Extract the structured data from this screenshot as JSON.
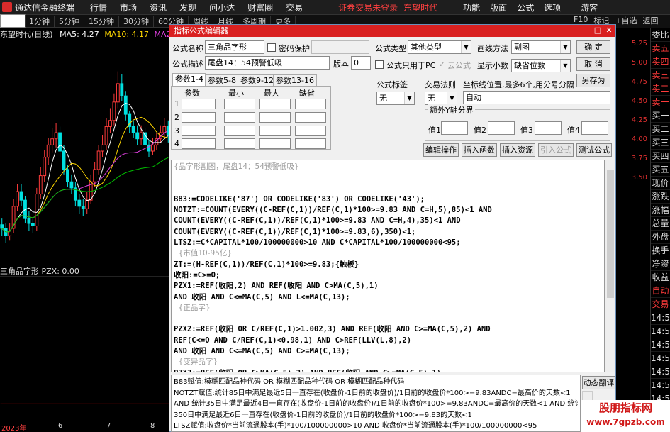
{
  "app": {
    "title": "通达信金融终端",
    "menu": [
      "行情",
      "市场",
      "资讯",
      "发现",
      "问小达",
      "财富圈",
      "交易"
    ],
    "warning": "证券交易未登录",
    "brand": "东望时代",
    "right_menu": [
      "功能",
      "版面",
      "公式",
      "选项"
    ],
    "visitor": "游客"
  },
  "periods": [
    "分时",
    "1分钟",
    "5分钟",
    "15分钟",
    "30分钟",
    "60分钟",
    "日线",
    "周线",
    "月线",
    "多周期",
    "更多"
  ],
  "top_right": [
    "F10",
    "标记",
    "+自选",
    "返回"
  ],
  "chart": {
    "name": "东望时代(日线)",
    "ma5": "MA5: 4.27",
    "ma10": "MA10: 4.17",
    "ma20": "MA20: 3.92",
    "sub_header": "三角品字形 PZX: 0.00",
    "x_labels": [
      "2023年",
      "6",
      "7",
      "8"
    ],
    "prices": [
      "5.25",
      "5.00",
      "4.75",
      "4.50",
      "4.25",
      "4.00",
      "3.75",
      "3.50"
    ],
    "colors": {
      "up": "#ff3b3b",
      "down": "#00e0e0",
      "ma5": "#ffffff",
      "ma10": "#ffd700",
      "ma20": "#e040e0",
      "ma60": "#00c000"
    },
    "series": {
      "open": [
        3.65,
        3.62,
        3.56,
        3.62,
        3.8,
        3.92,
        3.85,
        3.7,
        3.66,
        3.64,
        3.9,
        4.05,
        4.2,
        4.3,
        4.35,
        4.4,
        4.25,
        4.1,
        4.0,
        3.95,
        3.85,
        3.8,
        3.78,
        3.85,
        4.0,
        4.1,
        4.25,
        4.3,
        4.45,
        4.5,
        4.65,
        4.8,
        4.7,
        4.55,
        4.45,
        4.4,
        4.35,
        4.4,
        4.3,
        4.25,
        4.3,
        4.35,
        4.4,
        4.45
      ],
      "close": [
        3.62,
        3.56,
        3.6,
        3.8,
        3.92,
        3.85,
        3.7,
        3.66,
        3.64,
        3.9,
        4.05,
        4.2,
        4.3,
        4.35,
        4.4,
        4.25,
        4.1,
        4.0,
        3.95,
        3.85,
        3.8,
        3.78,
        3.85,
        4.0,
        4.1,
        4.25,
        4.3,
        4.45,
        4.5,
        4.65,
        4.8,
        4.7,
        4.55,
        4.45,
        4.4,
        4.35,
        4.4,
        4.3,
        4.25,
        4.3,
        4.35,
        4.4,
        4.45,
        4.38
      ],
      "high": [
        3.7,
        3.66,
        3.66,
        3.86,
        3.98,
        3.98,
        3.88,
        3.76,
        3.7,
        3.95,
        4.12,
        4.26,
        4.36,
        4.44,
        4.48,
        4.45,
        4.3,
        4.14,
        4.06,
        4.0,
        3.9,
        3.86,
        3.92,
        4.06,
        4.16,
        4.3,
        4.38,
        4.52,
        4.6,
        4.72,
        4.9,
        4.88,
        4.74,
        4.58,
        4.5,
        4.46,
        4.46,
        4.44,
        4.34,
        4.36,
        4.4,
        4.46,
        4.52,
        4.5
      ],
      "low": [
        3.56,
        3.5,
        3.52,
        3.58,
        3.76,
        3.8,
        3.66,
        3.6,
        3.58,
        3.6,
        3.86,
        4.0,
        4.14,
        4.24,
        4.28,
        4.2,
        4.06,
        3.96,
        3.9,
        3.8,
        3.74,
        3.72,
        3.74,
        3.82,
        3.96,
        4.06,
        4.2,
        4.26,
        4.4,
        4.46,
        4.6,
        4.66,
        4.5,
        4.4,
        4.36,
        4.3,
        4.3,
        4.26,
        4.2,
        4.22,
        4.26,
        4.32,
        4.36,
        4.32
      ]
    }
  },
  "right_panel": [
    "委比",
    "卖五",
    "卖四",
    "卖三",
    "卖二",
    "卖一",
    "买一",
    "买二",
    "买三",
    "买四",
    "买五",
    "现价",
    "涨跌",
    "涨幅",
    "总量",
    "外盘",
    "换手",
    "净资",
    "收益",
    "自动",
    "交易",
    "14:5",
    "14:5",
    "14:5",
    "14:5",
    "14:5",
    "14:5",
    "14:5",
    "14:5",
    "14:5"
  ],
  "dialog": {
    "title": "指标公式编辑器",
    "name_label": "公式名称",
    "name_value": "三角品字形",
    "pwd_label": "密码保护",
    "type_label": "公式类型",
    "type_value": "其他类型",
    "draw_label": "画线方法",
    "draw_value": "副图",
    "ok": "确  定",
    "desc_label": "公式描述",
    "desc_value": "尾盘14：54预警低吸",
    "ver_label": "版本",
    "ver_value": "0",
    "pc_only": "公式只用于PC",
    "cloud": "云公式",
    "decimal_label": "显示小数",
    "decimal_value": "缺省位数",
    "cancel": "取  消",
    "save_as": "另存为",
    "tabs": [
      "参数1-4",
      "参数5-8",
      "参数9-12",
      "参数13-16"
    ],
    "param_headers": [
      "参数",
      "最小",
      "最大",
      "缺省"
    ],
    "param_rows": [
      "1",
      "2",
      "3",
      "4"
    ],
    "tag_label": "公式标签",
    "tag_value": "无",
    "rule_label": "交易法则",
    "rule_value": "无",
    "axis_label": "坐标线位置,最多6个,用分号分隔",
    "axis_value": "自动",
    "extra_y": "额外Y轴分界",
    "values": [
      "值1",
      "值2",
      "值3",
      "值4"
    ],
    "buttons": [
      "编辑操作",
      "插入函数",
      "插入资源",
      "引入公式",
      "测试公式"
    ],
    "code": [
      {
        "cls": "c",
        "t": "{品字形副图，尾盘14：54预警低吸}"
      },
      {
        "cls": "",
        "t": ""
      },
      {
        "cls": "",
        "t": ""
      },
      {
        "cls": "",
        "t": "B83:=CODELIKE('87') OR CODELIKE('83') OR CODELIKE('43');"
      },
      {
        "cls": "",
        "t": "NOTZT:=COUNT(EVERY((C-REF(C,1))/REF(C,1)*100>=9.83 AND C=H,5),85)<1 AND"
      },
      {
        "cls": "",
        "t": "COUNT(EVERY((C-REF(C,1))/REF(C,1)*100>=9.83 AND C=H,4),35)<1 AND"
      },
      {
        "cls": "",
        "t": "COUNT(EVERY((C-REF(C,1))/REF(C,1)*100>=9.83,6),350)<1;"
      },
      {
        "cls": "",
        "t": "LTSZ:=C*CAPITAL*100/100000000>10 AND C*CAPITAL*100/100000000<95;"
      },
      {
        "cls": "c",
        "t": "  {市值10-95亿}"
      },
      {
        "cls": "",
        "t": "ZT:=(H-REF(C,1))/REF(C,1)*100>=9.83;{触板}"
      },
      {
        "cls": "",
        "t": "收阳:=C>=O;"
      },
      {
        "cls": "",
        "t": "PZX1:=REF(收阳,2) AND REF(收阳 AND C>MA(C,5),1)"
      },
      {
        "cls": "",
        "t": "AND 收阳 AND C<=MA(C,5) AND L<=MA(C,13);"
      },
      {
        "cls": "c",
        "t": "  {正品字}"
      },
      {
        "cls": "",
        "t": ""
      },
      {
        "cls": "",
        "t": "PZX2:=REF(收阳 OR C/REF(C,1)>1.002,3) AND REF(收阳 AND C>=MA(C,5),2) AND"
      },
      {
        "cls": "",
        "t": "REF(C<=O AND C/REF(C,1)<0.98,1) AND C>REF(LLV(L,8),2)"
      },
      {
        "cls": "",
        "t": "AND 收阳 AND C<=MA(C,5) AND C>=MA(C,13);"
      },
      {
        "cls": "c",
        "t": "  {变异品字}"
      },
      {
        "cls": "",
        "t": "PZX3:=REF(收阳 OR C>MA(C,5),2) AND REF(收阳 AND C>=MA(C,5),1)"
      }
    ],
    "explain": [
      "B83赋值:模糊匹配品种代码 OR 模糊匹配品种代码 OR 模糊匹配品种代码",
      "NOTZT赋值:统计85日中满足最近5日一直存在(收盘价-1日前的收盘价)/1日前的收盘价*100>=9.83ANDC=最高价的天数<1",
      "AND 统计35日中满足最近4日一直存在(收盘价-1日前的收盘价)/1日前的收盘价*100>=9.83ANDC=最高价的天数<1 AND 统计",
      "350日中满足最近6日一直存在(收盘价-1日前的收盘价)/1日前的收盘价*100>=9.83的天数<1",
      "LTSZ赋值:收盘价*当前流通股本(手)*100/100000000>10 AND 收盘价*当前流通股本(手)*100/100000000<95"
    ],
    "explain_btn": "动态翻译"
  },
  "watermark": {
    "title": "股朋指标网",
    "url": "www.7gpzb.com"
  }
}
